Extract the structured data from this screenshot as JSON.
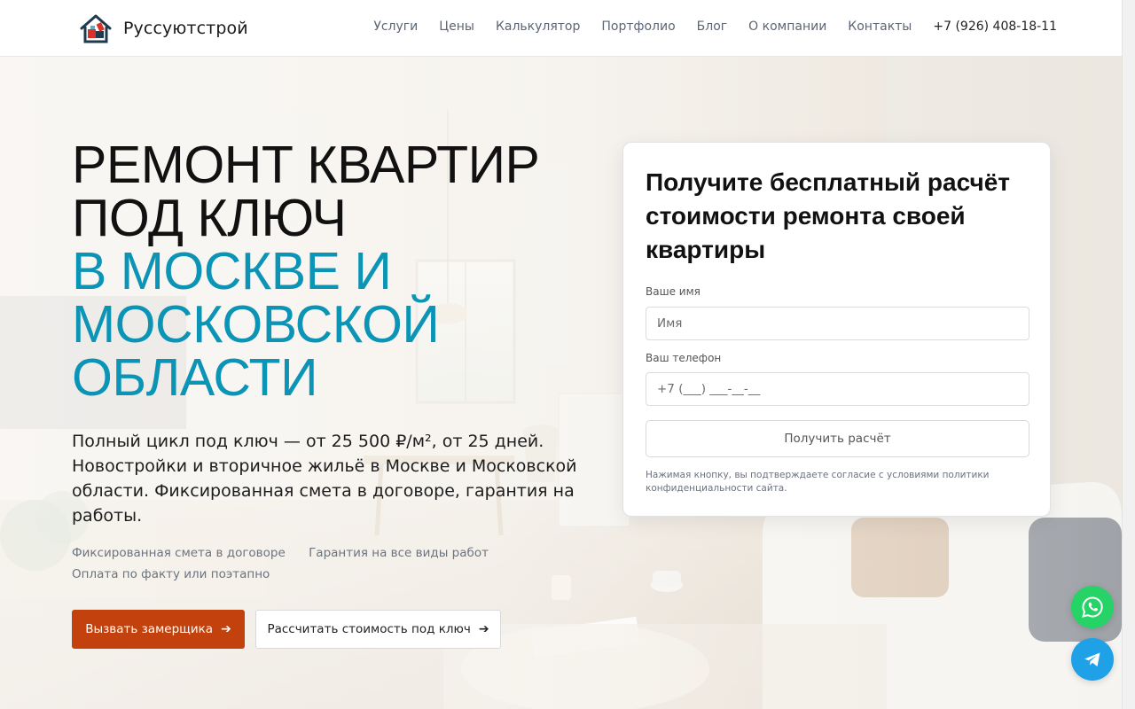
{
  "header": {
    "brand": "Руссуютстрой",
    "nav": [
      "Услуги",
      "Цены",
      "Калькулятор",
      "Портфолио",
      "Блог",
      "О компании",
      "Контакты"
    ],
    "phone": "+7 (926) 408-18-11"
  },
  "hero": {
    "title_line1": "РЕМОНТ КВАРТИР",
    "title_line2": "ПОД КЛЮЧ",
    "title_accent_line1": "В МОСКВЕ И",
    "title_accent_line2": "МОСКОВСКОЙ",
    "title_accent_line3": "ОБЛАСТИ",
    "description": "Полный цикл под ключ — от 25 500 ₽/м², от 25 дней. Новостройки и вторичное жильё в Москве и Московской области. Фиксированная смета в договоре, гарантия на работы.",
    "features": [
      "Фиксированная смета в договоре",
      "Гарантия на все виды работ",
      "Оплата по факту или поэтапно"
    ],
    "primary_button": "Вызвать замерщика",
    "secondary_button": "Рассчитать стоимость под ключ",
    "arrow": "➔"
  },
  "form": {
    "title": "Получите бесплатный расчёт стоимости ремонта своей квартиры",
    "name_label": "Ваше имя",
    "name_placeholder": "Имя",
    "phone_label": "Ваш телефон",
    "phone_placeholder": "+7 (___) ___-__-__",
    "submit_label": "Получить расчёт",
    "consent": "Нажимая кнопку, вы подтверждаете согласие с условиями политики конфиденциальности сайта."
  },
  "floating": {
    "whatsapp_icon": "whatsapp-icon",
    "telegram_icon": "telegram-icon"
  },
  "colors": {
    "accent": "#0b94b5",
    "cta": "#c2410c",
    "whatsapp": "#25d366",
    "telegram": "#1ea1e6"
  }
}
